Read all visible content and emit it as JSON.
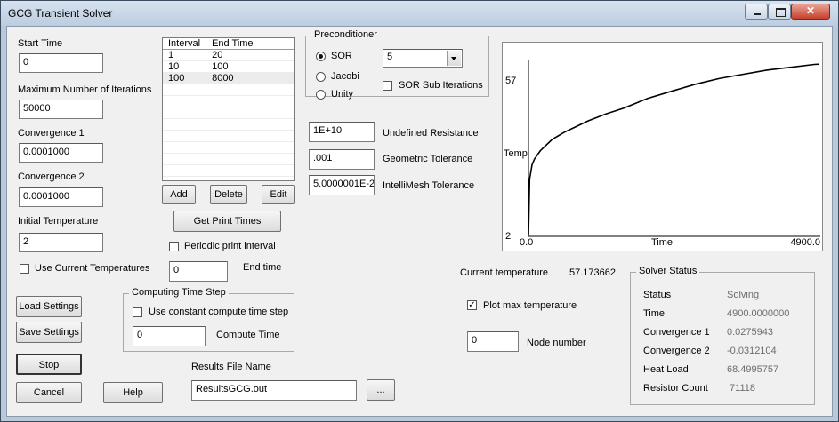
{
  "window": {
    "title": "GCG Transient Solver"
  },
  "start_time": {
    "label": "Start Time",
    "value": "0"
  },
  "max_iterations": {
    "label": "Maximum Number of Iterations",
    "value": "50000"
  },
  "convergence1": {
    "label": "Convergence 1",
    "value": "0.0001000"
  },
  "convergence2": {
    "label": "Convergence 2",
    "value": "0.0001000"
  },
  "initial_temperature": {
    "label": "Initial Temperature",
    "value": "2"
  },
  "use_current_temperatures": {
    "label": "Use Current Temperatures",
    "checked": false
  },
  "interval_table": {
    "headers": [
      "Interval",
      "End Time"
    ],
    "rows": [
      [
        "1",
        "20"
      ],
      [
        "10",
        "100"
      ],
      [
        "100",
        "8000"
      ]
    ]
  },
  "table_buttons": {
    "add": "Add",
    "delete": "Delete",
    "edit": "Edit"
  },
  "get_print_times": "Get Print Times",
  "periodic_print": {
    "label": "Periodic print interval",
    "checked": false
  },
  "end_time": {
    "value": "0",
    "label": "End time"
  },
  "preconditioner": {
    "title": "Preconditioner",
    "options": [
      "SOR",
      "Jacobi",
      "Unity"
    ],
    "selected": "SOR",
    "select_value": "5",
    "sub_iterations": {
      "label": "SOR Sub Iterations",
      "checked": false
    }
  },
  "tolerances": {
    "undefined_resistance": {
      "value": "1E+10",
      "label": "Undefined Resistance"
    },
    "geometric_tolerance": {
      "value": ".001",
      "label": "Geometric Tolerance"
    },
    "intellimesh_tolerance": {
      "value": "5.0000001E-2",
      "label": "IntelliMesh Tolerance"
    }
  },
  "computing_time_step": {
    "title": "Computing Time Step",
    "use_constant": {
      "label": "Use constant compute time step",
      "checked": false
    },
    "compute_time": {
      "value": "0",
      "label": "Compute Time"
    }
  },
  "buttons": {
    "load_settings": "Load Settings",
    "save_settings": "Save Settings",
    "stop": "Stop",
    "cancel": "Cancel",
    "help": "Help",
    "browse": "..."
  },
  "results_file": {
    "label": "Results File Name",
    "value": "ResultsGCG.out"
  },
  "current_temperature": {
    "label": "Current temperature",
    "value": "57.173662"
  },
  "plot_max_temperature": {
    "label": "Plot max temperature",
    "checked": true
  },
  "node_number": {
    "value": "0",
    "label": "Node number"
  },
  "solver_status": {
    "title": "Solver Status",
    "rows": [
      {
        "label": "Status",
        "value": "Solving"
      },
      {
        "label": "Time",
        "value": "4900.0000000"
      },
      {
        "label": "Convergence 1",
        "value": "0.0275943"
      },
      {
        "label": "Convergence 2",
        "value": "-0.0312104"
      },
      {
        "label": "Heat Load",
        "value": "68.4995757"
      },
      {
        "label": "Resistor Count",
        "value": " 71118"
      }
    ]
  },
  "chart_data": {
    "type": "line",
    "ylabel": "Temp",
    "xlabel": "Time",
    "xlim": [
      0,
      4900
    ],
    "ylim": [
      2,
      57
    ],
    "x_tick_labels": [
      "0.0",
      "4900.0"
    ],
    "y_tick_labels": [
      "2",
      "57"
    ],
    "series": [
      {
        "x": [
          0,
          20,
          60,
          100,
          200,
          400,
          600,
          800,
          1000,
          1300,
          1600,
          2000,
          2400,
          2800,
          3200,
          3600,
          4000,
          4400,
          4800,
          4900
        ],
        "y": [
          2,
          22,
          27,
          29,
          32,
          36,
          38.5,
          40.5,
          42.5,
          45,
          47,
          50.5,
          53,
          55.5,
          57.5,
          59,
          60.5,
          61.5,
          62.5,
          62.6
        ]
      }
    ],
    "color": "#000000"
  }
}
